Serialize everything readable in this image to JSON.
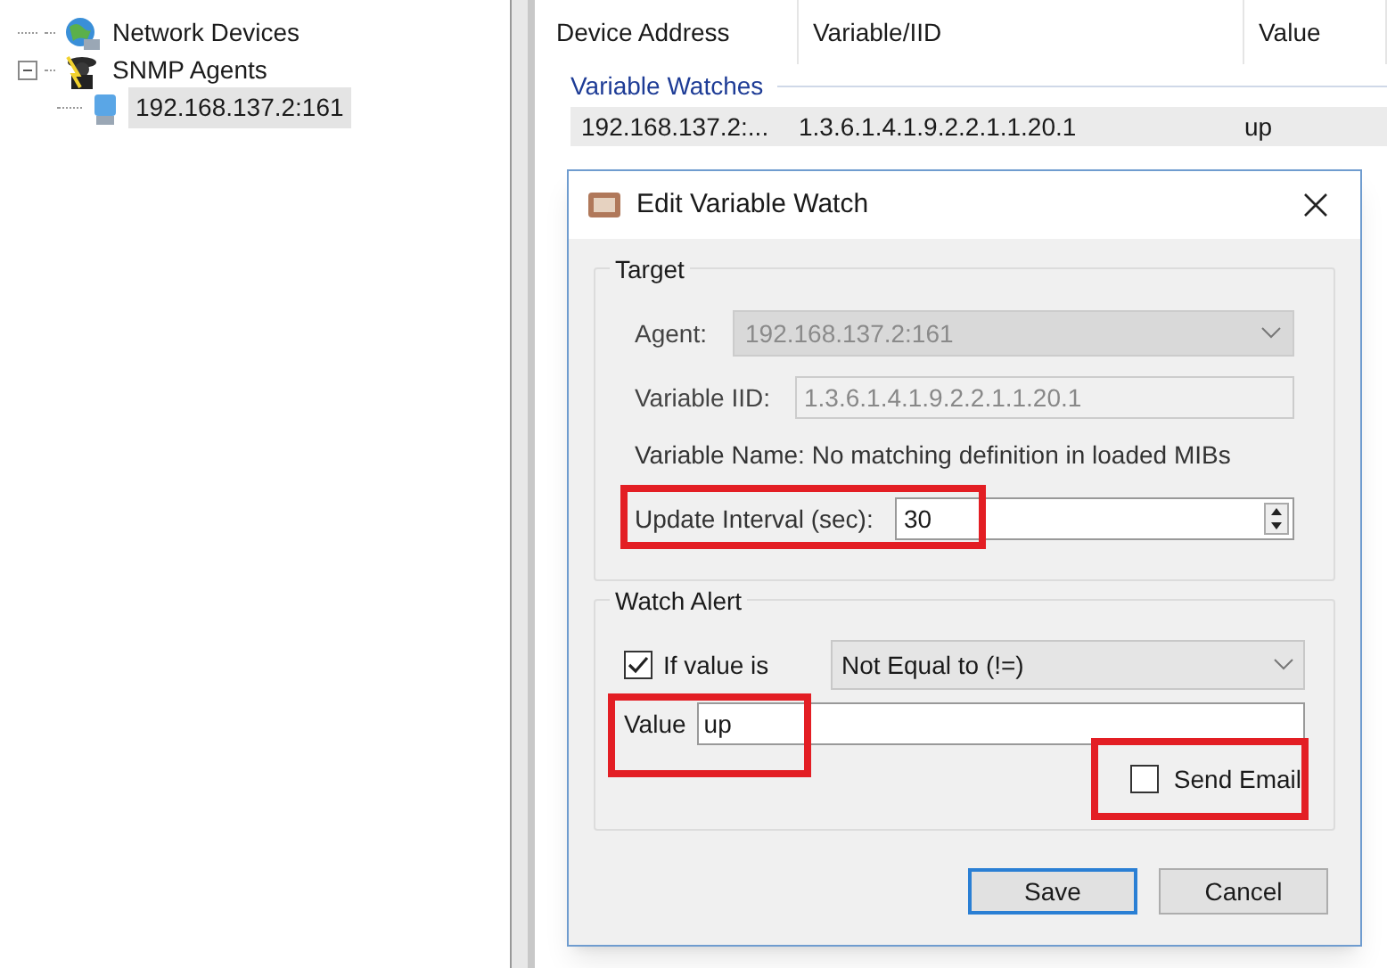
{
  "tree": [
    {
      "label": "Network Devices"
    },
    {
      "label": "SNMP Agents",
      "expanded": true,
      "children": [
        {
          "label": "192.168.137.2:161",
          "selected": true
        }
      ]
    }
  ],
  "list": {
    "columns": [
      "Device Address",
      "Variable/IID",
      "Value"
    ],
    "group": "Variable Watches",
    "rows": [
      {
        "cells": [
          "192.168.137.2:...",
          "1.3.6.1.4.1.9.2.2.1.1.20.1",
          "up"
        ]
      }
    ]
  },
  "dialog": {
    "title": "Edit Variable Watch",
    "target": {
      "legend": "Target",
      "agent": {
        "label": "Agent:",
        "value": "192.168.137.2:161",
        "disabled": true
      },
      "variable_iid": {
        "label": "Variable IID:",
        "value": "1.3.6.1.4.1.9.2.2.1.1.20.1",
        "disabled": true
      },
      "variable_name": "Variable Name: No matching definition in loaded MIBs",
      "update_interval": {
        "label": "Update Interval (sec):",
        "value": "30",
        "highlighted": true
      }
    },
    "watch_alert": {
      "legend": "Watch Alert",
      "condition": {
        "label": "If value is",
        "checked": true,
        "value": "Not Equal to (!=)"
      },
      "value": {
        "label": "Value",
        "value": "up",
        "highlighted": true
      },
      "send_email": {
        "label": "Send Email",
        "checked": false,
        "highlighted": true
      }
    },
    "buttons": [
      {
        "label": "Save",
        "default": true
      },
      {
        "label": "Cancel",
        "default": false
      }
    ]
  }
}
